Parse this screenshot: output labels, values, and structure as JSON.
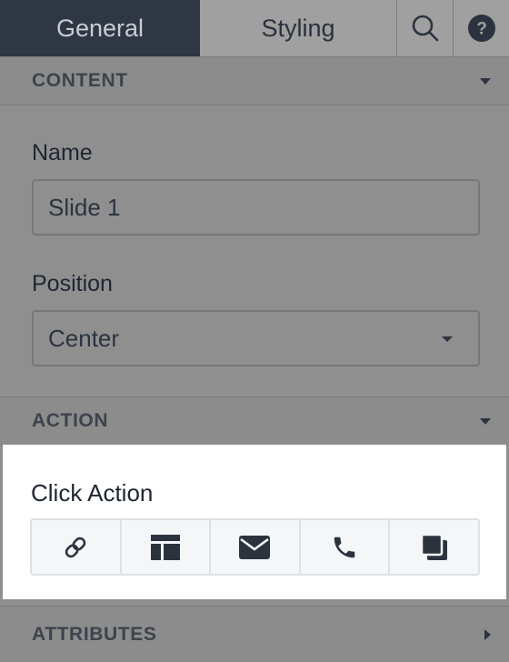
{
  "tabs": {
    "general": "General",
    "styling": "Styling"
  },
  "icons": {
    "search": "search-icon",
    "help": "help-icon"
  },
  "sections": {
    "content": "CONTENT",
    "action": "ACTION",
    "attributes": "ATTRIBUTES"
  },
  "fields": {
    "name_label": "Name",
    "name_value": "Slide 1",
    "position_label": "Position",
    "position_value": "Center"
  },
  "click_action": {
    "label": "Click Action",
    "buttons": [
      "link-icon",
      "layout-icon",
      "envelope-icon",
      "phone-icon",
      "copy-icon"
    ]
  },
  "colors": {
    "active_tab": "#2f3744",
    "overlay": "#8f8f8f",
    "panel": "#ffffff",
    "icon": "#2c333f"
  }
}
